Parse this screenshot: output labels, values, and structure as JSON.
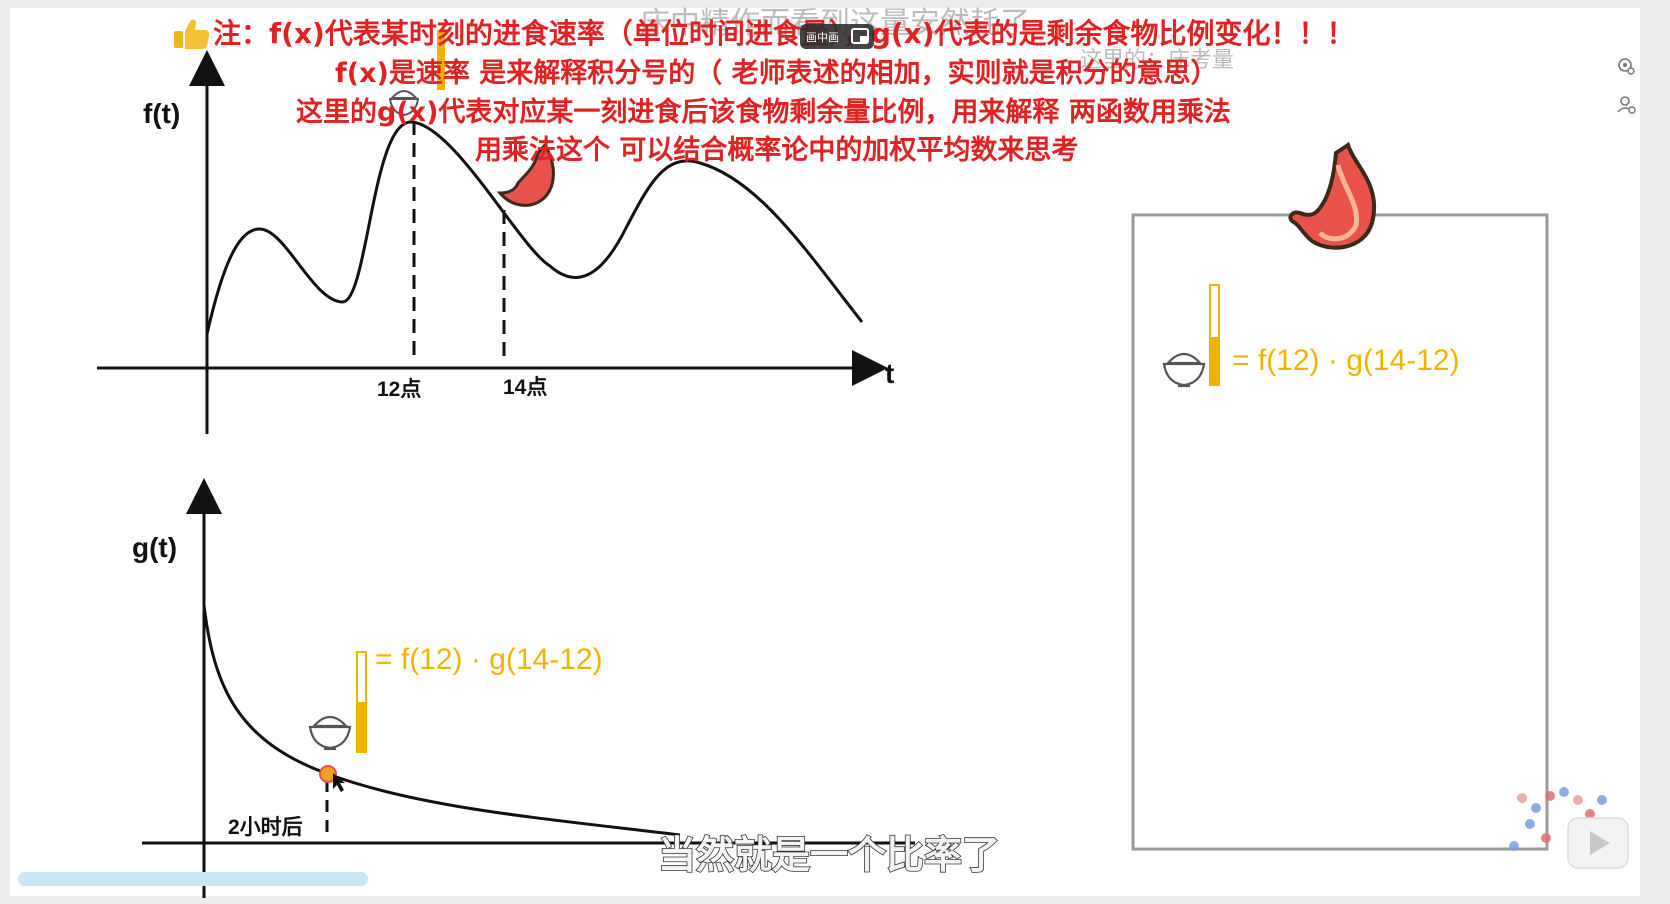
{
  "notes": {
    "line1": "注：f(x)代表某时刻的进食速率（单位时间进食量），g(x)代表的是剩余食物比例变化！！！",
    "line2": "f(x)是速率 是来解释积分号的（ 老师表述的相加，实则就是积分的意思）",
    "line3": "这里的g(x)代表对应某一刻进食后该食物剩余量比例，用来解释 两函数用乘法",
    "line4": "用乘法这个   可以结合概率论中的加权平均数来思考",
    "thumb_icon": "thumbs-up-icon"
  },
  "ghost_text": {
    "top": "床中精作而看到这量安然耗了",
    "mid": "这里的：床考量"
  },
  "pip_badge": {
    "label": "画中画",
    "icon": "pip-exit-icon"
  },
  "chart_f": {
    "ylabel": "f(t)",
    "xlabel": "t",
    "tick_12": "12点",
    "tick_14": "14点"
  },
  "chart_g": {
    "ylabel": "g(t)",
    "tick_2h": "2小时后",
    "formula": "= f(12) · g(14-12)"
  },
  "stomach_panel": {
    "formula": "= f(12) · g(14-12)"
  },
  "subtitle": "当然就是一个比率了",
  "side_icons": [
    "settings-icon",
    "user-icon"
  ],
  "colors": {
    "accent_red": "#e02222",
    "formula_yellow": "#f0b400",
    "stomach_red": "#e8524a",
    "panel_border": "#9a9a9a"
  }
}
